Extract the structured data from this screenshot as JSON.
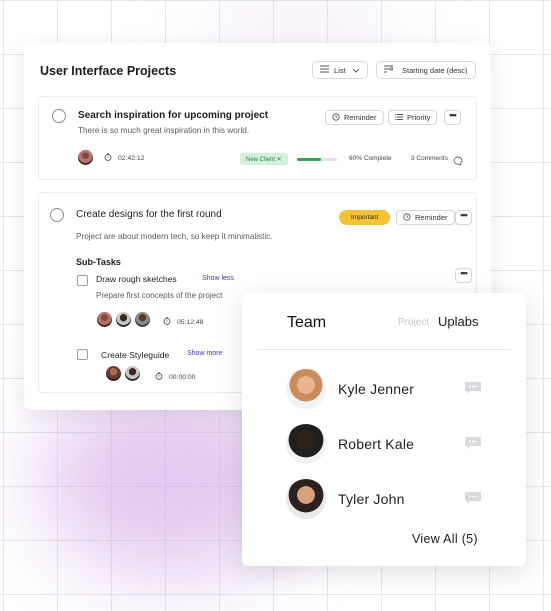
{
  "projects": {
    "title": "User Interface Projects",
    "view_label": "List",
    "sort_label": "Starting date (desc)"
  },
  "task1": {
    "title": "Search inspiration for upcoming project",
    "description": "There is so much great inspiration in this world.",
    "reminder_label": "Reminder",
    "priority_label": "Priority",
    "timer": "02:42:12",
    "tag": "New Client ✕",
    "progress": 0.6,
    "progress_label": "60% Complete",
    "comments": "3 Comments"
  },
  "task2": {
    "title": "Create designs for the first round",
    "badge": "Important",
    "reminder_label": "Reminder",
    "description": "Project are about modern tech, so keep it  minimalistic.",
    "subtasks_label": "Sub-Tasks",
    "subtasks": [
      {
        "title": "Draw rough sketches",
        "toggle": "Show less",
        "description": "Prepare first concepts of the project",
        "timer": "05:12:48"
      },
      {
        "title": "Create Styleguide",
        "toggle": "Show more",
        "timer": "00:00:00"
      }
    ]
  },
  "team": {
    "title": "Team",
    "tab_project": "Project",
    "tab_uplabs": "Uplabs",
    "members": [
      {
        "name": "Kyle Jenner"
      },
      {
        "name": "Robert Kale"
      },
      {
        "name": "Tyler John"
      }
    ],
    "view_all": "View All (5)"
  },
  "colors": {
    "important": "#f2c237",
    "progress": "#2fa84f",
    "link": "#4a2fbf",
    "tag_bg": "#d4f0d9"
  },
  "icons": [
    "list-icon",
    "chevron-down-icon",
    "sort-icon",
    "reminder-icon",
    "priority-icon",
    "more-icon",
    "timer-icon",
    "comment-icon",
    "chat-icon"
  ]
}
